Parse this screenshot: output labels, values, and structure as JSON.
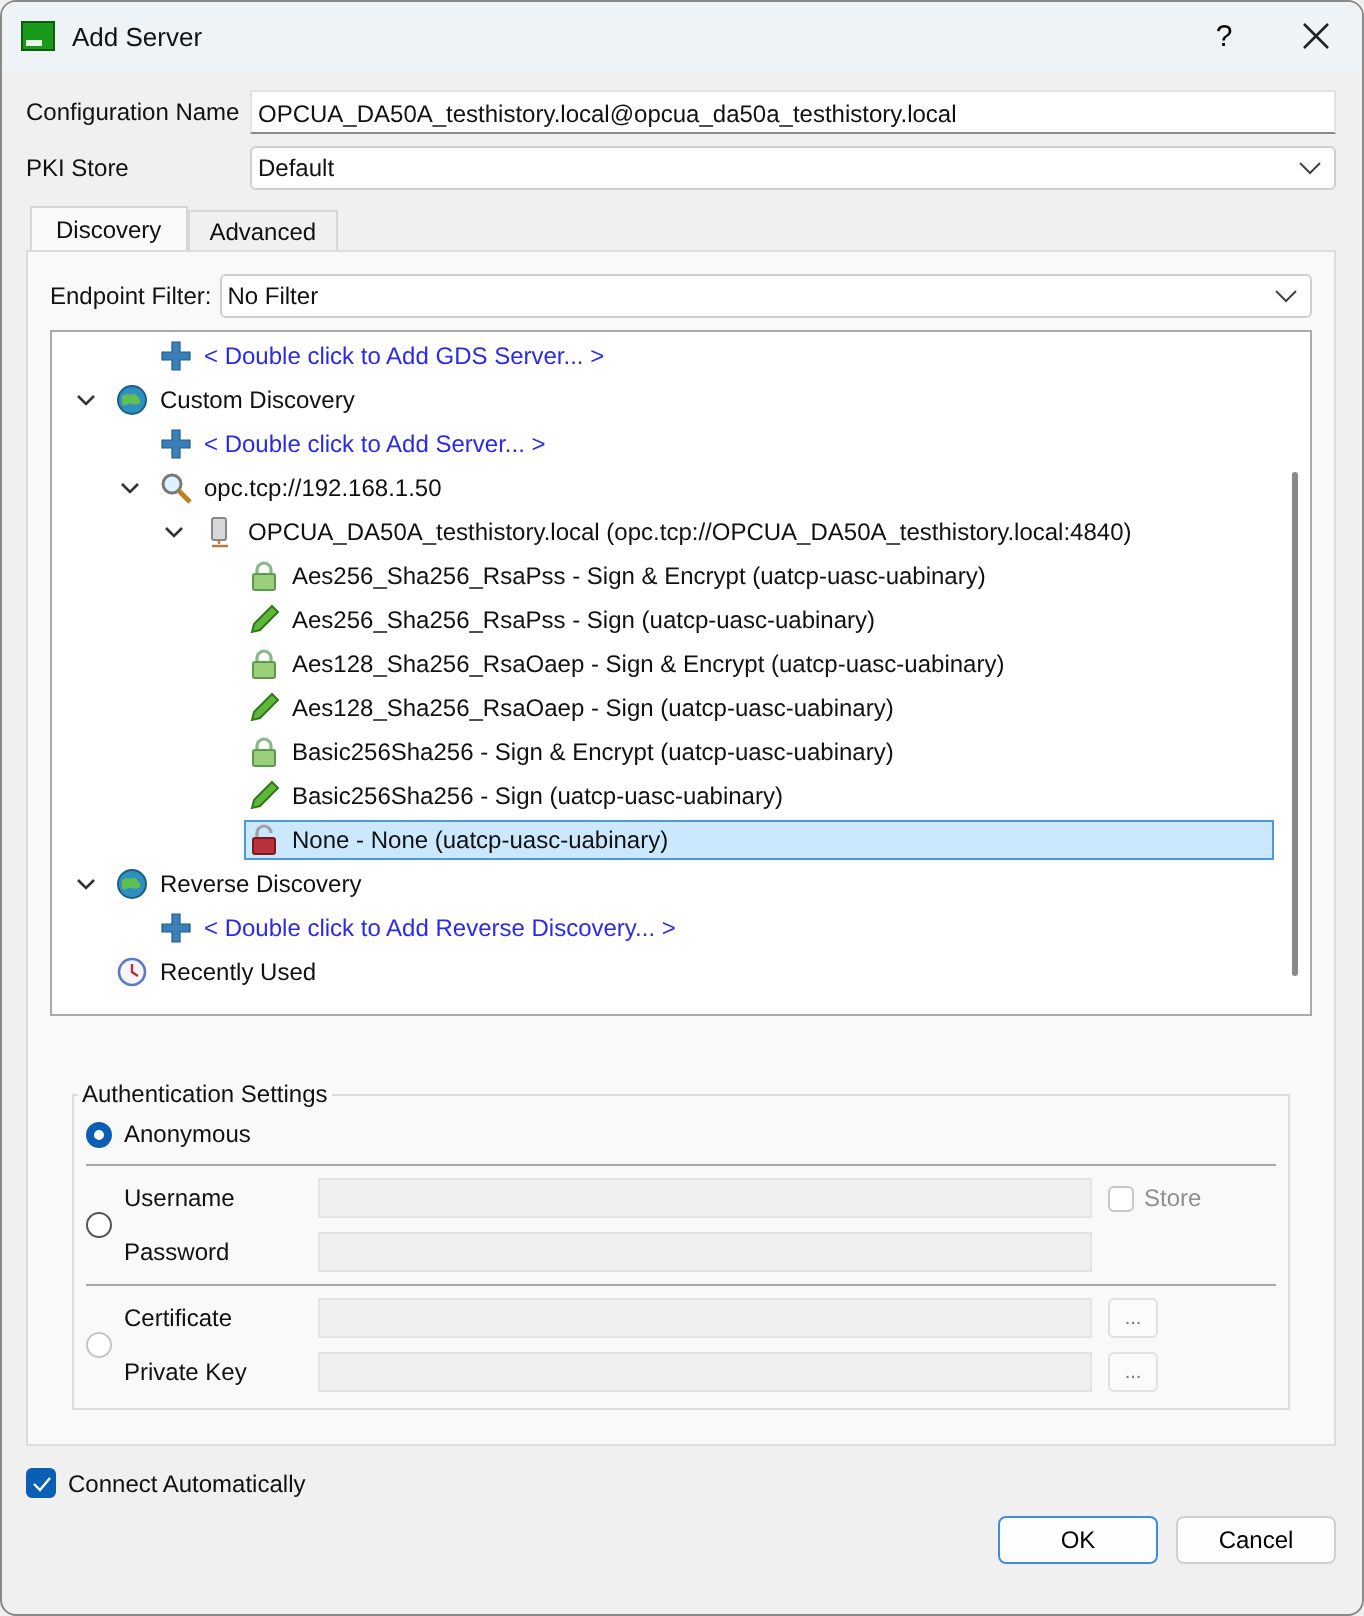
{
  "window": {
    "title": "Add Server",
    "help": "?"
  },
  "config_name": {
    "label": "Configuration Name",
    "value": "OPCUA_DA50A_testhistory.local@opcua_da50a_testhistory.local"
  },
  "pki_store": {
    "label": "PKI Store",
    "value": "Default"
  },
  "tabs": [
    {
      "label": "Discovery",
      "selected": true
    },
    {
      "label": "Advanced",
      "selected": false
    }
  ],
  "endpoint_filter": {
    "label": "Endpoint Filter:",
    "value": "No Filter"
  },
  "tree": {
    "items": [
      {
        "children": [
          {
            "kind": "add",
            "label": "< Double click to Add GDS Server... >",
            "selected": false
          }
        ]
      },
      {
        "kind": "discovery",
        "label": "Custom Discovery",
        "expanded": true,
        "selected": false,
        "children": [
          {
            "kind": "add",
            "label": "< Double click to Add Server... >",
            "selected": false
          },
          {
            "kind": "search",
            "label": "opc.tcp://192.168.1.50",
            "expanded": true,
            "selected": false,
            "children": [
              {
                "kind": "server",
                "label": "OPCUA_DA50A_testhistory.local (opc.tcp://OPCUA_DA50A_testhistory.local:4840)",
                "expanded": true,
                "selected": false,
                "children": [
                  {
                    "kind": "encrypt",
                    "label": "Aes256_Sha256_RsaPss - Sign & Encrypt (uatcp-uasc-uabinary)",
                    "selected": false
                  },
                  {
                    "kind": "sign",
                    "label": "Aes256_Sha256_RsaPss - Sign (uatcp-uasc-uabinary)",
                    "selected": false
                  },
                  {
                    "kind": "encrypt",
                    "label": "Aes128_Sha256_RsaOaep - Sign & Encrypt (uatcp-uasc-uabinary)",
                    "selected": false
                  },
                  {
                    "kind": "sign",
                    "label": "Aes128_Sha256_RsaOaep - Sign (uatcp-uasc-uabinary)",
                    "selected": false
                  },
                  {
                    "kind": "encrypt",
                    "label": "Basic256Sha256 - Sign & Encrypt (uatcp-uasc-uabinary)",
                    "selected": false
                  },
                  {
                    "kind": "sign",
                    "label": "Basic256Sha256 - Sign (uatcp-uasc-uabinary)",
                    "selected": false
                  },
                  {
                    "kind": "none",
                    "label": "None - None (uatcp-uasc-uabinary)",
                    "selected": true
                  }
                ]
              }
            ]
          }
        ]
      },
      {
        "kind": "discovery",
        "label": "Reverse Discovery",
        "expanded": true,
        "selected": false,
        "children": [
          {
            "kind": "add",
            "label": "< Double click to Add Reverse Discovery... >",
            "selected": false
          }
        ]
      },
      {
        "kind": "recent",
        "label": "Recently Used",
        "selected": false
      }
    ]
  },
  "auth": {
    "title": "Authentication Settings",
    "options": [
      {
        "selected": true,
        "disabled": false,
        "label": "Anonymous"
      },
      {
        "selected": false,
        "disabled": false,
        "fields": [
          {
            "label": "Username",
            "disabled": true,
            "store": {
              "label": "Store",
              "checked": false,
              "disabled": true
            }
          },
          {
            "label": "Password",
            "disabled": true
          }
        ]
      },
      {
        "selected": false,
        "disabled": true,
        "fields": [
          {
            "label": "Certificate",
            "disabled": true,
            "button": "..."
          },
          {
            "label": "Private Key",
            "disabled": true,
            "button": "..."
          }
        ]
      }
    ]
  },
  "connect_automatically": {
    "label": "Connect Automatically",
    "checked": true
  },
  "buttons": [
    {
      "label": "OK",
      "default": true
    },
    {
      "label": "Cancel",
      "default": false
    }
  ]
}
